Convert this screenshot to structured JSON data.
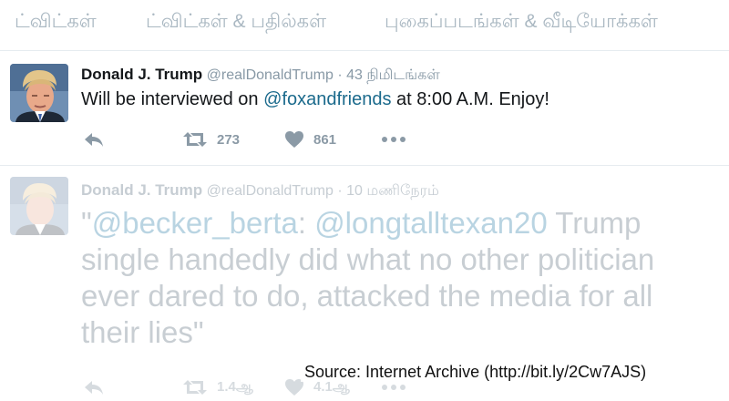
{
  "tabs": [
    {
      "label": "ட்விட்கள்"
    },
    {
      "label": "ட்விட்கள் & பதில்கள்"
    },
    {
      "label": "புகைப்படங்கள் & வீடியோக்கள்"
    }
  ],
  "tweets": [
    {
      "name": "Donald J. Trump",
      "handle": "@realDonaldTrump",
      "separator": "·",
      "time": "43 நிமிடங்கள்",
      "text_before": "Will be interviewed on ",
      "mention": "@foxandfriends",
      "text_after": " at 8:00 A.M. Enjoy!",
      "retweets": "273",
      "likes": "861"
    },
    {
      "name": "Donald J. Trump",
      "handle": "@realDonaldTrump",
      "separator": "·",
      "time": "10 மணிநேரம்",
      "quote_open": "\"",
      "mention_1": "@becker_berta",
      "mid_1": ": ",
      "mention_2": "@longtalltexan20",
      "line_1_rest": " Trump",
      "line_2": "single handedly did what no other politician",
      "line_3": "ever dared to do, attacked the media for all",
      "line_4": "their lies\"",
      "retweets": "1.4ஆ",
      "likes": "4.1ஆ"
    }
  ],
  "icons": {
    "reply": "reply-icon",
    "retweet": "retweet-icon",
    "like": "heart-icon",
    "more": "more-icon"
  },
  "colors": {
    "mention": "#1b6a8c",
    "muted": "#8899a6",
    "faded": "#c8ced3"
  },
  "caption": "Source: Internet Archive (http://bit.ly/2Cw7AJS)"
}
